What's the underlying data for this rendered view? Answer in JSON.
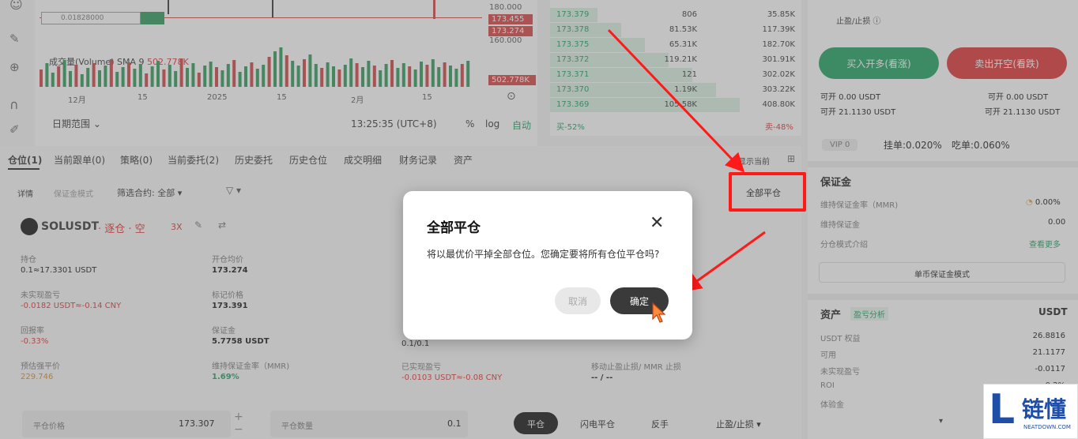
{
  "chart": {
    "price_tag_top": "180.000",
    "price_tag_1": "173.455",
    "price_tag_2": "173.274",
    "price_tag_3": "160.000",
    "order_line_value": "0.01828000",
    "volume_label": "成交量(Volume) SMA 9",
    "volume_value": "502.778K",
    "volume_tag": "502.778K",
    "x_axis": [
      "12月",
      "15",
      "2025",
      "15",
      "2月",
      "15"
    ],
    "date_range": "日期范围",
    "clock": "13:25:35 (UTC+8)",
    "percent_btn": "%",
    "log_btn": "log",
    "auto_btn": "自动",
    "volume_bars": [
      22,
      30,
      18,
      26,
      34,
      20,
      28,
      16,
      24,
      30,
      21,
      27,
      35,
      19,
      25,
      31,
      23,
      29,
      17,
      26,
      33,
      22,
      28,
      20,
      36,
      24,
      30,
      18,
      27,
      32,
      25,
      21,
      29,
      34,
      19,
      26,
      31,
      23,
      28,
      38,
      45,
      52,
      40,
      33,
      27,
      35,
      41,
      29,
      24,
      31,
      26,
      22,
      28,
      36,
      30,
      25,
      33,
      27,
      21,
      29,
      34,
      24,
      30,
      26,
      22,
      32,
      28,
      35,
      25,
      31,
      27,
      23,
      29,
      33
    ]
  },
  "orderbook": {
    "rows": [
      {
        "price": "173.379",
        "qty": "806",
        "total": "35.85K"
      },
      {
        "price": "173.378",
        "qty": "81.53K",
        "total": "117.39K"
      },
      {
        "price": "173.375",
        "qty": "65.31K",
        "total": "182.70K"
      },
      {
        "price": "173.372",
        "qty": "119.21K",
        "total": "301.91K"
      },
      {
        "price": "173.371",
        "qty": "121",
        "total": "302.02K"
      },
      {
        "price": "173.370",
        "qty": "1.19K",
        "total": "303.22K"
      },
      {
        "price": "173.369",
        "qty": "105.58K",
        "total": "408.80K"
      }
    ],
    "buy_pct": "买-52%",
    "sell_pct": "卖-48%"
  },
  "tabs": [
    "仓位(1)",
    "当前跟单(0)",
    "策略(0)",
    "当前委托(2)",
    "历史委托",
    "历史仓位",
    "成交明细",
    "财务记录",
    "资产"
  ],
  "show_current": "只显示当前",
  "filter": {
    "detail": "详情",
    "combine": "保证金模式",
    "label": "筛选合约: 全部"
  },
  "close_all_btn": "全部平仓",
  "position": {
    "symbol": "SOLUSDT",
    "tags": "· 逐仓 · 空",
    "leverage": "3X",
    "fields": [
      {
        "label": "持仓",
        "value": "0.1≈17.3301 USDT",
        "cls": "val"
      },
      {
        "label": "开仓均价",
        "value": "173.274",
        "cls": "val"
      },
      {
        "label": "未实现盈亏",
        "value": "-0.0182 USDT≈-0.14 CNY",
        "cls": "red"
      },
      {
        "label": "标记价格",
        "value": "173.391",
        "cls": "val"
      },
      {
        "label": "回报率",
        "value": "-0.33%",
        "cls": "red"
      },
      {
        "label": "保证金",
        "value": "5.7758 USDT",
        "cls": "val"
      },
      {
        "label": "预估强平价",
        "value": "229.746",
        "cls": "orange"
      },
      {
        "label": "维持保证金率（MMR)",
        "value": "1.69%",
        "cls": "green"
      }
    ],
    "ratio_val": "0.1/0.1",
    "realized_label": "已实现盈亏",
    "realized_value": "-0.0103 USDT≈-0.08 CNY",
    "tpsl_label": "移动止盈止损/ MMR 止损",
    "tpsl_value": "-- / --"
  },
  "bottom_bar": {
    "price_label": "平仓价格",
    "price_value": "173.307",
    "qty_label": "平仓数量",
    "qty_value": "0.1",
    "close_btn": "平仓",
    "flash_btn": "闪电平仓",
    "reverse_btn": "反手",
    "tpsl_btn": "止盈/止损"
  },
  "right_panel": {
    "tpsl_label": "止盈/止损",
    "buy_btn": "买入开多(看涨)",
    "sell_btn": "卖出开空(看跌)",
    "can_open_left": "可开 0.00 USDT",
    "can_open_right": "可开 0.00 USDT",
    "avail_left": "可开 21.1130 USDT",
    "avail_right": "可开 21.1130 USDT",
    "vip_label": "VIP 0",
    "maker_fee": "挂单:0.020%",
    "taker_fee": "吃单:0.060%",
    "margin_title": "保证金",
    "mmr_label": "维持保证金率（MMR)",
    "mmr_value": "0.00%",
    "maint_label": "维持保证金",
    "maint_value": "0.00",
    "cross_label": "分仓模式介绍",
    "see_more": "查看更多",
    "single_mode": "单币保证金模式",
    "assets_title": "资产",
    "pnl_link": "盈亏分析",
    "currency": "USDT",
    "asset_rows": [
      {
        "label": "USDT 权益",
        "value": "26.8816"
      },
      {
        "label": "可用",
        "value": "21.1177"
      },
      {
        "label": "未实现盈亏",
        "value": "-0.0117"
      },
      {
        "label": "ROI",
        "value": "-0.2%"
      },
      {
        "label": "体验金",
        "value": ""
      }
    ]
  },
  "modal": {
    "title": "全部平仓",
    "message": "将以最优价平掉全部仓位。您确定要将所有仓位平仓吗?",
    "cancel": "取消",
    "confirm": "确定"
  },
  "watermark": {
    "letter": "L",
    "text": "链懂",
    "sub": "NEATDOWN.COM"
  },
  "colors": {
    "accent_red": "#ff1a1a",
    "buy_green": "#1aa060",
    "sell_red": "#e03030"
  }
}
